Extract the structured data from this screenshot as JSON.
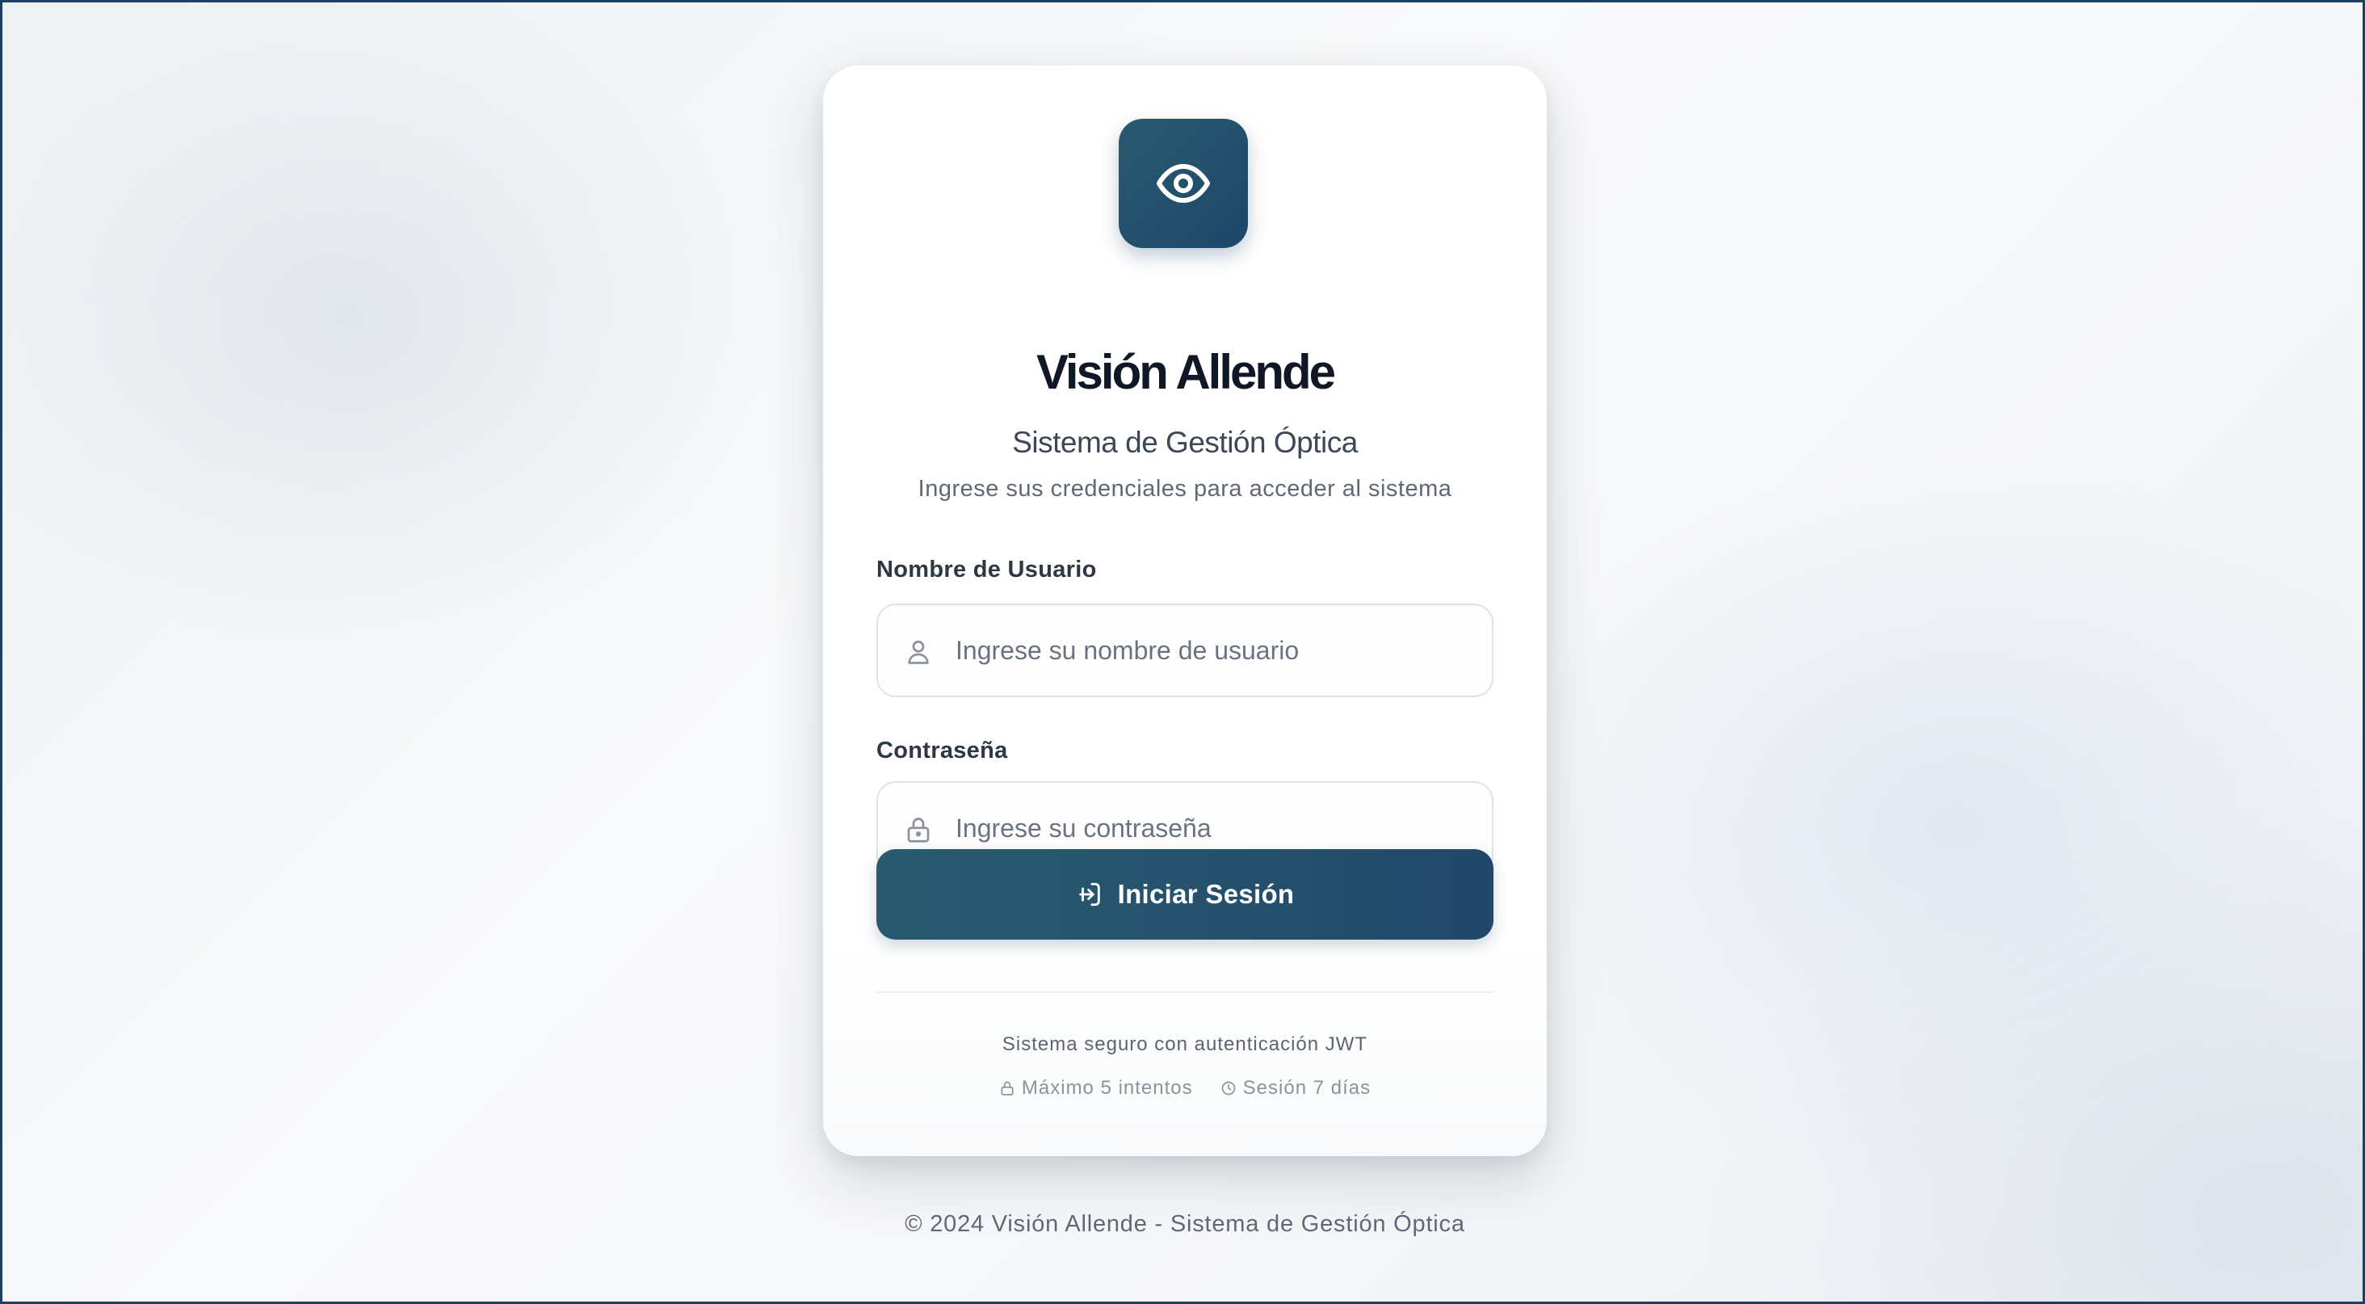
{
  "brand": {
    "logo_icon": "eye-icon",
    "title": "Visión Allende",
    "subtitle": "Sistema de Gestión Óptica",
    "description": "Ingrese sus credenciales para acceder al sistema",
    "accent_color": "#21486a"
  },
  "form": {
    "username": {
      "label": "Nombre de Usuario",
      "placeholder": "Ingrese su nombre de usuario",
      "value": "",
      "icon": "user-icon"
    },
    "password": {
      "label": "Contraseña",
      "placeholder": "Ingrese su contraseña",
      "value": "",
      "icon": "lock-icon"
    },
    "submit": {
      "label": "Iniciar Sesión",
      "icon": "login-icon"
    }
  },
  "security": {
    "note": "Sistema seguro con autenticación JWT",
    "max_attempts": "Máximo 5 intentos",
    "max_attempts_icon": "lock-icon",
    "session": "Sesión 7 días",
    "session_icon": "clock-icon"
  },
  "footer": {
    "copyright": "© 2024 Visión Allende - Sistema de Gestión Óptica"
  }
}
